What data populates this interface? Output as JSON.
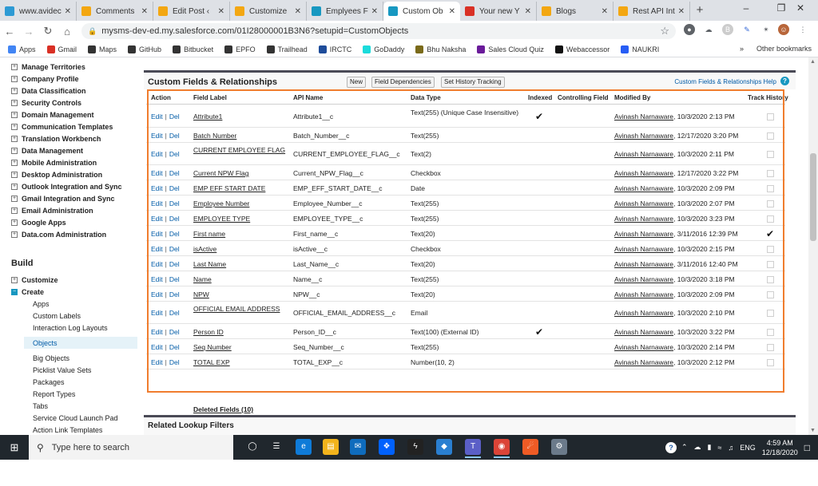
{
  "browser": {
    "tabs": [
      {
        "label": "www.avidec",
        "icon": "globe-icon",
        "color": "#2d9ad4"
      },
      {
        "label": "Comments",
        "icon": "blogger-icon",
        "color": "#f3a712"
      },
      {
        "label": "Edit Post ‹",
        "icon": "blogger-icon",
        "color": "#f3a712"
      },
      {
        "label": "Customize",
        "icon": "blogger-icon",
        "color": "#f3a712"
      },
      {
        "label": "Emplyees F",
        "icon": "salesforce-icon",
        "color": "#1798c1"
      },
      {
        "label": "Custom Ob",
        "icon": "salesforce-icon",
        "color": "#1798c1",
        "active": true
      },
      {
        "label": "Your new Y",
        "icon": "gmail-icon",
        "color": "#d93025"
      },
      {
        "label": "Blogs",
        "icon": "blogger-icon",
        "color": "#f3a712"
      },
      {
        "label": "Rest API Int",
        "icon": "blogger-icon",
        "color": "#f3a712"
      }
    ],
    "url": "mysms-dev-ed.my.salesforce.com/01I28000001B3N6?setupid=CustomObjects",
    "bookmarks": [
      {
        "label": "Apps",
        "icon": "apps-icon",
        "color": "#4285f4"
      },
      {
        "label": "Gmail",
        "icon": "gmail-icon",
        "color": "#d93025"
      },
      {
        "label": "Maps",
        "icon": "github-icon",
        "color": "#333333"
      },
      {
        "label": "GitHub",
        "icon": "github-icon",
        "color": "#333333"
      },
      {
        "label": "Bitbucket",
        "icon": "github-icon",
        "color": "#333333"
      },
      {
        "label": "EPFO",
        "icon": "github-icon",
        "color": "#333333"
      },
      {
        "label": "Trailhead",
        "icon": "github-icon",
        "color": "#333333"
      },
      {
        "label": "IRCTC",
        "icon": "irctc-icon",
        "color": "#1e4c9a"
      },
      {
        "label": "GoDaddy",
        "icon": "godaddy-icon",
        "color": "#1bdbdb"
      },
      {
        "label": "Bhu Naksha",
        "icon": "map-icon",
        "color": "#7a6a1a"
      },
      {
        "label": "Sales Cloud Quiz",
        "icon": "quiz-icon",
        "color": "#6a1b9a"
      },
      {
        "label": "Webaccessor",
        "icon": "web-icon",
        "color": "#111111"
      },
      {
        "label": "NAUKRI",
        "icon": "naukri-icon",
        "color": "#275df5"
      }
    ],
    "more_bookmarks": "»",
    "other_bookmarks": "Other bookmarks"
  },
  "sidebar": {
    "top_items": [
      "Manage Territories",
      "Company Profile",
      "Data Classification",
      "Security Controls",
      "Domain Management",
      "Communication Templates",
      "Translation Workbench",
      "Data Management",
      "Mobile Administration",
      "Desktop Administration",
      "Outlook Integration and Sync",
      "Gmail Integration and Sync",
      "Email Administration",
      "Google Apps",
      "Data.com Administration"
    ],
    "build_heading": "Build",
    "build_items": [
      "Customize",
      "Create"
    ],
    "create_subitems": [
      "Apps",
      "Custom Labels",
      "Interaction Log Layouts",
      "Objects",
      "Big Objects",
      "Picklist Value Sets",
      "Packages",
      "Report Types",
      "Tabs",
      "Service Cloud Launch Pad",
      "Action Link Templates"
    ],
    "selected": "Objects"
  },
  "panel": {
    "title": "Custom Fields & Relationships",
    "buttons": [
      "New",
      "Field Dependencies",
      "Set History Tracking"
    ],
    "help": "Custom Fields & Relationships Help",
    "columns": [
      "Action",
      "Field Label",
      "API Name",
      "Data Type",
      "Indexed",
      "Controlling Field",
      "Modified By",
      "Track History"
    ],
    "edit_label": "Edit",
    "del_label": "Del",
    "sep": "|",
    "rows": [
      {
        "label": "Attribute1",
        "api": "Attribute1__c",
        "type": "Text(255) (Unique Case Insensitive)",
        "indexed": true,
        "by": "Avinash Narnaware",
        "when": ", 10/3/2020 2:13 PM",
        "track": false
      },
      {
        "label": "Batch Number",
        "api": "Batch_Number__c",
        "type": "Text(255)",
        "indexed": false,
        "by": "Avinash Narnaware",
        "when": ", 12/17/2020 3:20 PM",
        "track": false
      },
      {
        "label": "CURRENT EMPLOYEE FLAG",
        "api": "CURRENT_EMPLOYEE_FLAG__c",
        "type": "Text(2)",
        "indexed": false,
        "by": "Avinash Narnaware",
        "when": ", 10/3/2020 2:11 PM",
        "track": false
      },
      {
        "label": "Current NPW Flag",
        "api": "Current_NPW_Flag__c",
        "type": "Checkbox",
        "indexed": false,
        "by": "Avinash Narnaware",
        "when": ", 12/17/2020 3:22 PM",
        "track": false
      },
      {
        "label": "EMP EFF START DATE",
        "api": "EMP_EFF_START_DATE__c",
        "type": "Date",
        "indexed": false,
        "by": "Avinash Narnaware",
        "when": ", 10/3/2020 2:09 PM",
        "track": false
      },
      {
        "label": "Employee Number",
        "api": "Employee_Number__c",
        "type": "Text(255)",
        "indexed": false,
        "by": "Avinash Narnaware",
        "when": ", 10/3/2020 2:07 PM",
        "track": false
      },
      {
        "label": "EMPLOYEE TYPE",
        "api": "EMPLOYEE_TYPE__c",
        "type": "Text(255)",
        "indexed": false,
        "by": "Avinash Narnaware",
        "when": ", 10/3/2020 3:23 PM",
        "track": false
      },
      {
        "label": "First name",
        "api": "First_name__c",
        "type": "Text(20)",
        "indexed": false,
        "by": "Avinash Narnaware",
        "when": ", 3/11/2016 12:39 PM",
        "track": true
      },
      {
        "label": "isActive",
        "api": "isActive__c",
        "type": "Checkbox",
        "indexed": false,
        "by": "Avinash Narnaware",
        "when": ", 10/3/2020 2:15 PM",
        "track": false
      },
      {
        "label": "Last Name",
        "api": "Last_Name__c",
        "type": "Text(20)",
        "indexed": false,
        "by": "Avinash Narnaware",
        "when": ", 3/11/2016 12:40 PM",
        "track": false
      },
      {
        "label": "Name",
        "api": "Name__c",
        "type": "Text(255)",
        "indexed": false,
        "by": "Avinash Narnaware",
        "when": ", 10/3/2020 3:18 PM",
        "track": false
      },
      {
        "label": "NPW",
        "api": "NPW__c",
        "type": "Text(20)",
        "indexed": false,
        "by": "Avinash Narnaware",
        "when": ", 10/3/2020 2:09 PM",
        "track": false
      },
      {
        "label": "OFFICIAL EMAIL ADDRESS",
        "api": "OFFICIAL_EMAIL_ADDRESS__c",
        "type": "Email",
        "indexed": false,
        "by": "Avinash Narnaware",
        "when": ", 10/3/2020 2:10 PM",
        "track": false
      },
      {
        "label": "Person ID",
        "api": "Person_ID__c",
        "type": "Text(100) (External ID)",
        "indexed": true,
        "by": "Avinash Narnaware",
        "when": ", 10/3/2020 3:22 PM",
        "track": false
      },
      {
        "label": "Seq Number",
        "api": "Seq_Number__c",
        "type": "Text(255)",
        "indexed": false,
        "by": "Avinash Narnaware",
        "when": ", 10/3/2020 2:14 PM",
        "track": false
      },
      {
        "label": "TOTAL EXP",
        "api": "TOTAL_EXP__c",
        "type": "Number(10, 2)",
        "indexed": false,
        "by": "Avinash Narnaware",
        "when": ", 10/3/2020 2:12 PM",
        "track": false
      }
    ],
    "deleted_fields": "Deleted Fields (10)",
    "related_title": "Related Lookup Filters"
  },
  "taskbar": {
    "search_placeholder": "Type here to search",
    "lang": "ENG",
    "time": "4:59 AM",
    "date": "12/18/2020"
  },
  "colors": {
    "highlight": "#f07d2e",
    "link": "#015ba7",
    "salesforce": "#1798c1"
  }
}
